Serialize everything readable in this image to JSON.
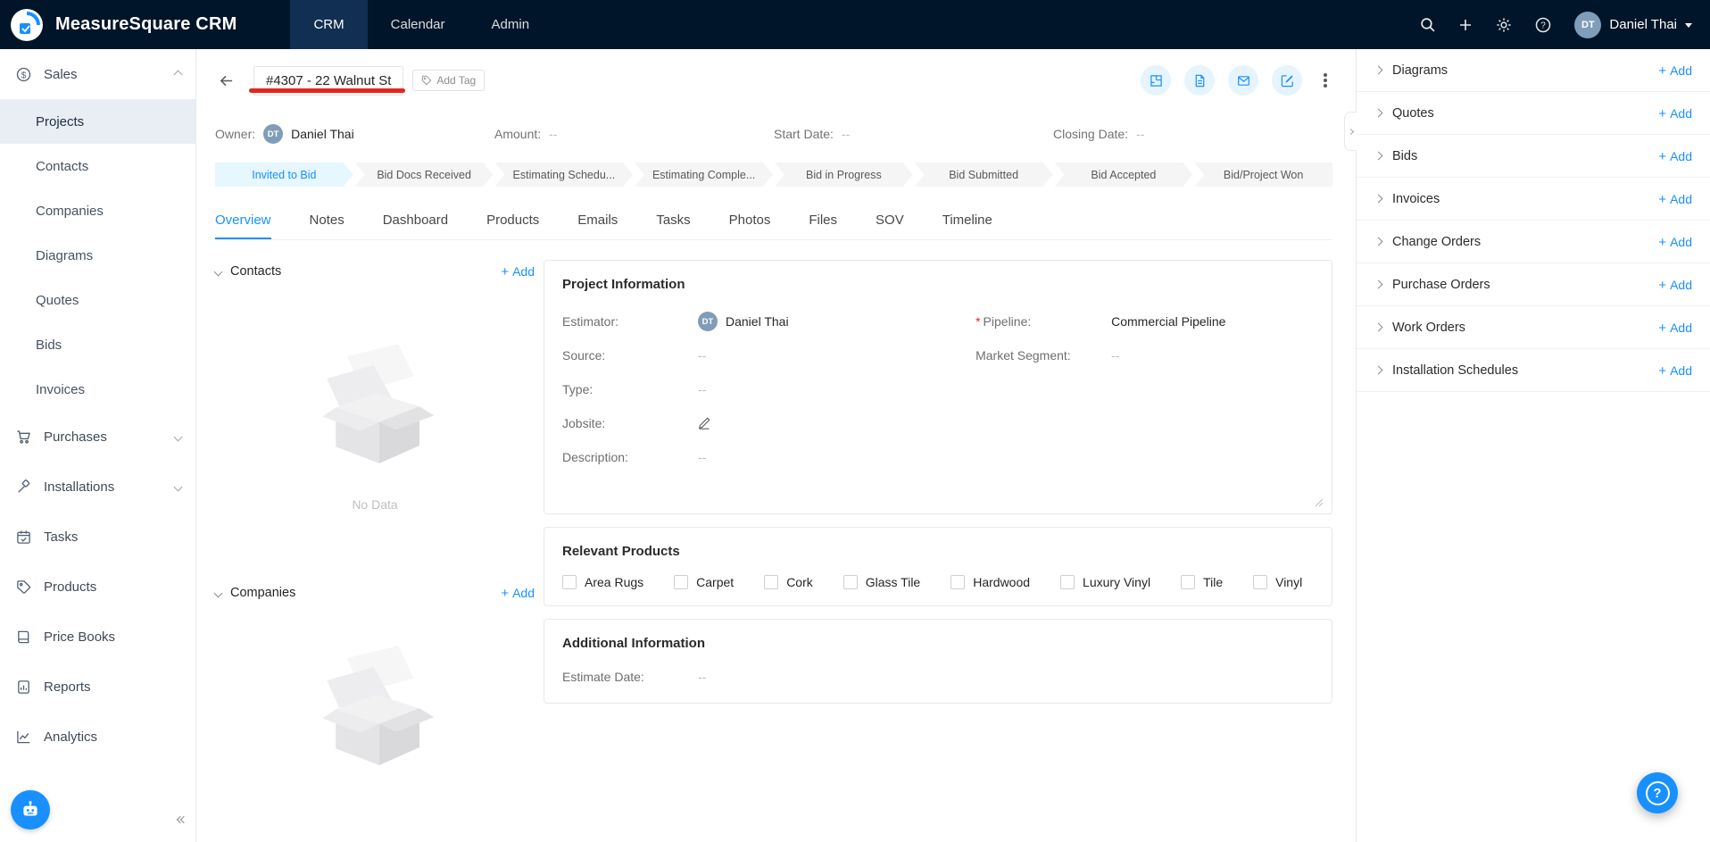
{
  "topbar": {
    "brand": "MeasureSquare CRM",
    "nav": [
      {
        "label": "CRM",
        "active": true
      },
      {
        "label": "Calendar",
        "active": false
      },
      {
        "label": "Admin",
        "active": false
      }
    ],
    "user": {
      "initials": "DT",
      "name": "Daniel Thai"
    }
  },
  "sidebar": {
    "items": [
      {
        "label": "Sales"
      },
      {
        "label": "Projects"
      },
      {
        "label": "Contacts"
      },
      {
        "label": "Companies"
      },
      {
        "label": "Diagrams"
      },
      {
        "label": "Quotes"
      },
      {
        "label": "Bids"
      },
      {
        "label": "Invoices"
      },
      {
        "label": "Purchases"
      },
      {
        "label": "Installations"
      },
      {
        "label": "Tasks"
      },
      {
        "label": "Products"
      },
      {
        "label": "Price Books"
      },
      {
        "label": "Reports"
      },
      {
        "label": "Analytics"
      }
    ]
  },
  "header": {
    "title": "#4307 - 22 Walnut St",
    "add_tag": "Add Tag"
  },
  "summary": {
    "owner_label": "Owner:",
    "owner_initials": "DT",
    "owner_value": "Daniel Thai",
    "amount_label": "Amount:",
    "amount_value": "--",
    "start_label": "Start Date:",
    "start_value": "--",
    "closing_label": "Closing Date:",
    "closing_value": "--"
  },
  "pipeline_stages": [
    {
      "label": "Invited to Bid",
      "active": true
    },
    {
      "label": "Bid Docs Received",
      "active": false
    },
    {
      "label": "Estimating Schedu...",
      "active": false
    },
    {
      "label": "Estimating Comple...",
      "active": false
    },
    {
      "label": "Bid in Progress",
      "active": false
    },
    {
      "label": "Bid Submitted",
      "active": false
    },
    {
      "label": "Bid Accepted",
      "active": false
    },
    {
      "label": "Bid/Project Won",
      "active": false
    }
  ],
  "tabs": [
    "Overview",
    "Notes",
    "Dashboard",
    "Products",
    "Emails",
    "Tasks",
    "Photos",
    "Files",
    "SOV",
    "Timeline"
  ],
  "contacts_panel": {
    "title": "Contacts",
    "add": "Add",
    "empty": "No Data"
  },
  "companies_panel": {
    "title": "Companies",
    "add": "Add"
  },
  "project_info": {
    "title": "Project Information",
    "estimator_label": "Estimator:",
    "estimator_initials": "DT",
    "estimator_value": "Daniel Thai",
    "source_label": "Source:",
    "source_value": "--",
    "type_label": "Type:",
    "type_value": "--",
    "jobsite_label": "Jobsite:",
    "description_label": "Description:",
    "description_value": "--",
    "required_mark": "*",
    "pipeline_label": "Pipeline:",
    "pipeline_value": "Commercial Pipeline",
    "market_label": "Market Segment:",
    "market_value": "--"
  },
  "relevant_products": {
    "title": "Relevant Products",
    "options": [
      "Area Rugs",
      "Carpet",
      "Cork",
      "Glass Tile",
      "Hardwood",
      "Luxury Vinyl",
      "Tile",
      "Vinyl"
    ]
  },
  "additional_info": {
    "title": "Additional Information",
    "estimate_label": "Estimate Date:",
    "estimate_value": "--"
  },
  "related_panels": [
    {
      "label": "Diagrams",
      "add": "Add"
    },
    {
      "label": "Quotes",
      "add": "Add"
    },
    {
      "label": "Bids",
      "add": "Add"
    },
    {
      "label": "Invoices",
      "add": "Add"
    },
    {
      "label": "Change Orders",
      "add": "Add"
    },
    {
      "label": "Purchase Orders",
      "add": "Add"
    },
    {
      "label": "Work Orders",
      "add": "Add"
    },
    {
      "label": "Installation Schedules",
      "add": "Add"
    }
  ],
  "colors": {
    "accent": "#1890ff",
    "navbar_bg": "#001529",
    "stage_active_bg": "#e6f7ff",
    "sidebar_selected_bg": "#e9eef4",
    "avatar_bg": "#7f9db9",
    "annotation_red": "#e0271c"
  }
}
